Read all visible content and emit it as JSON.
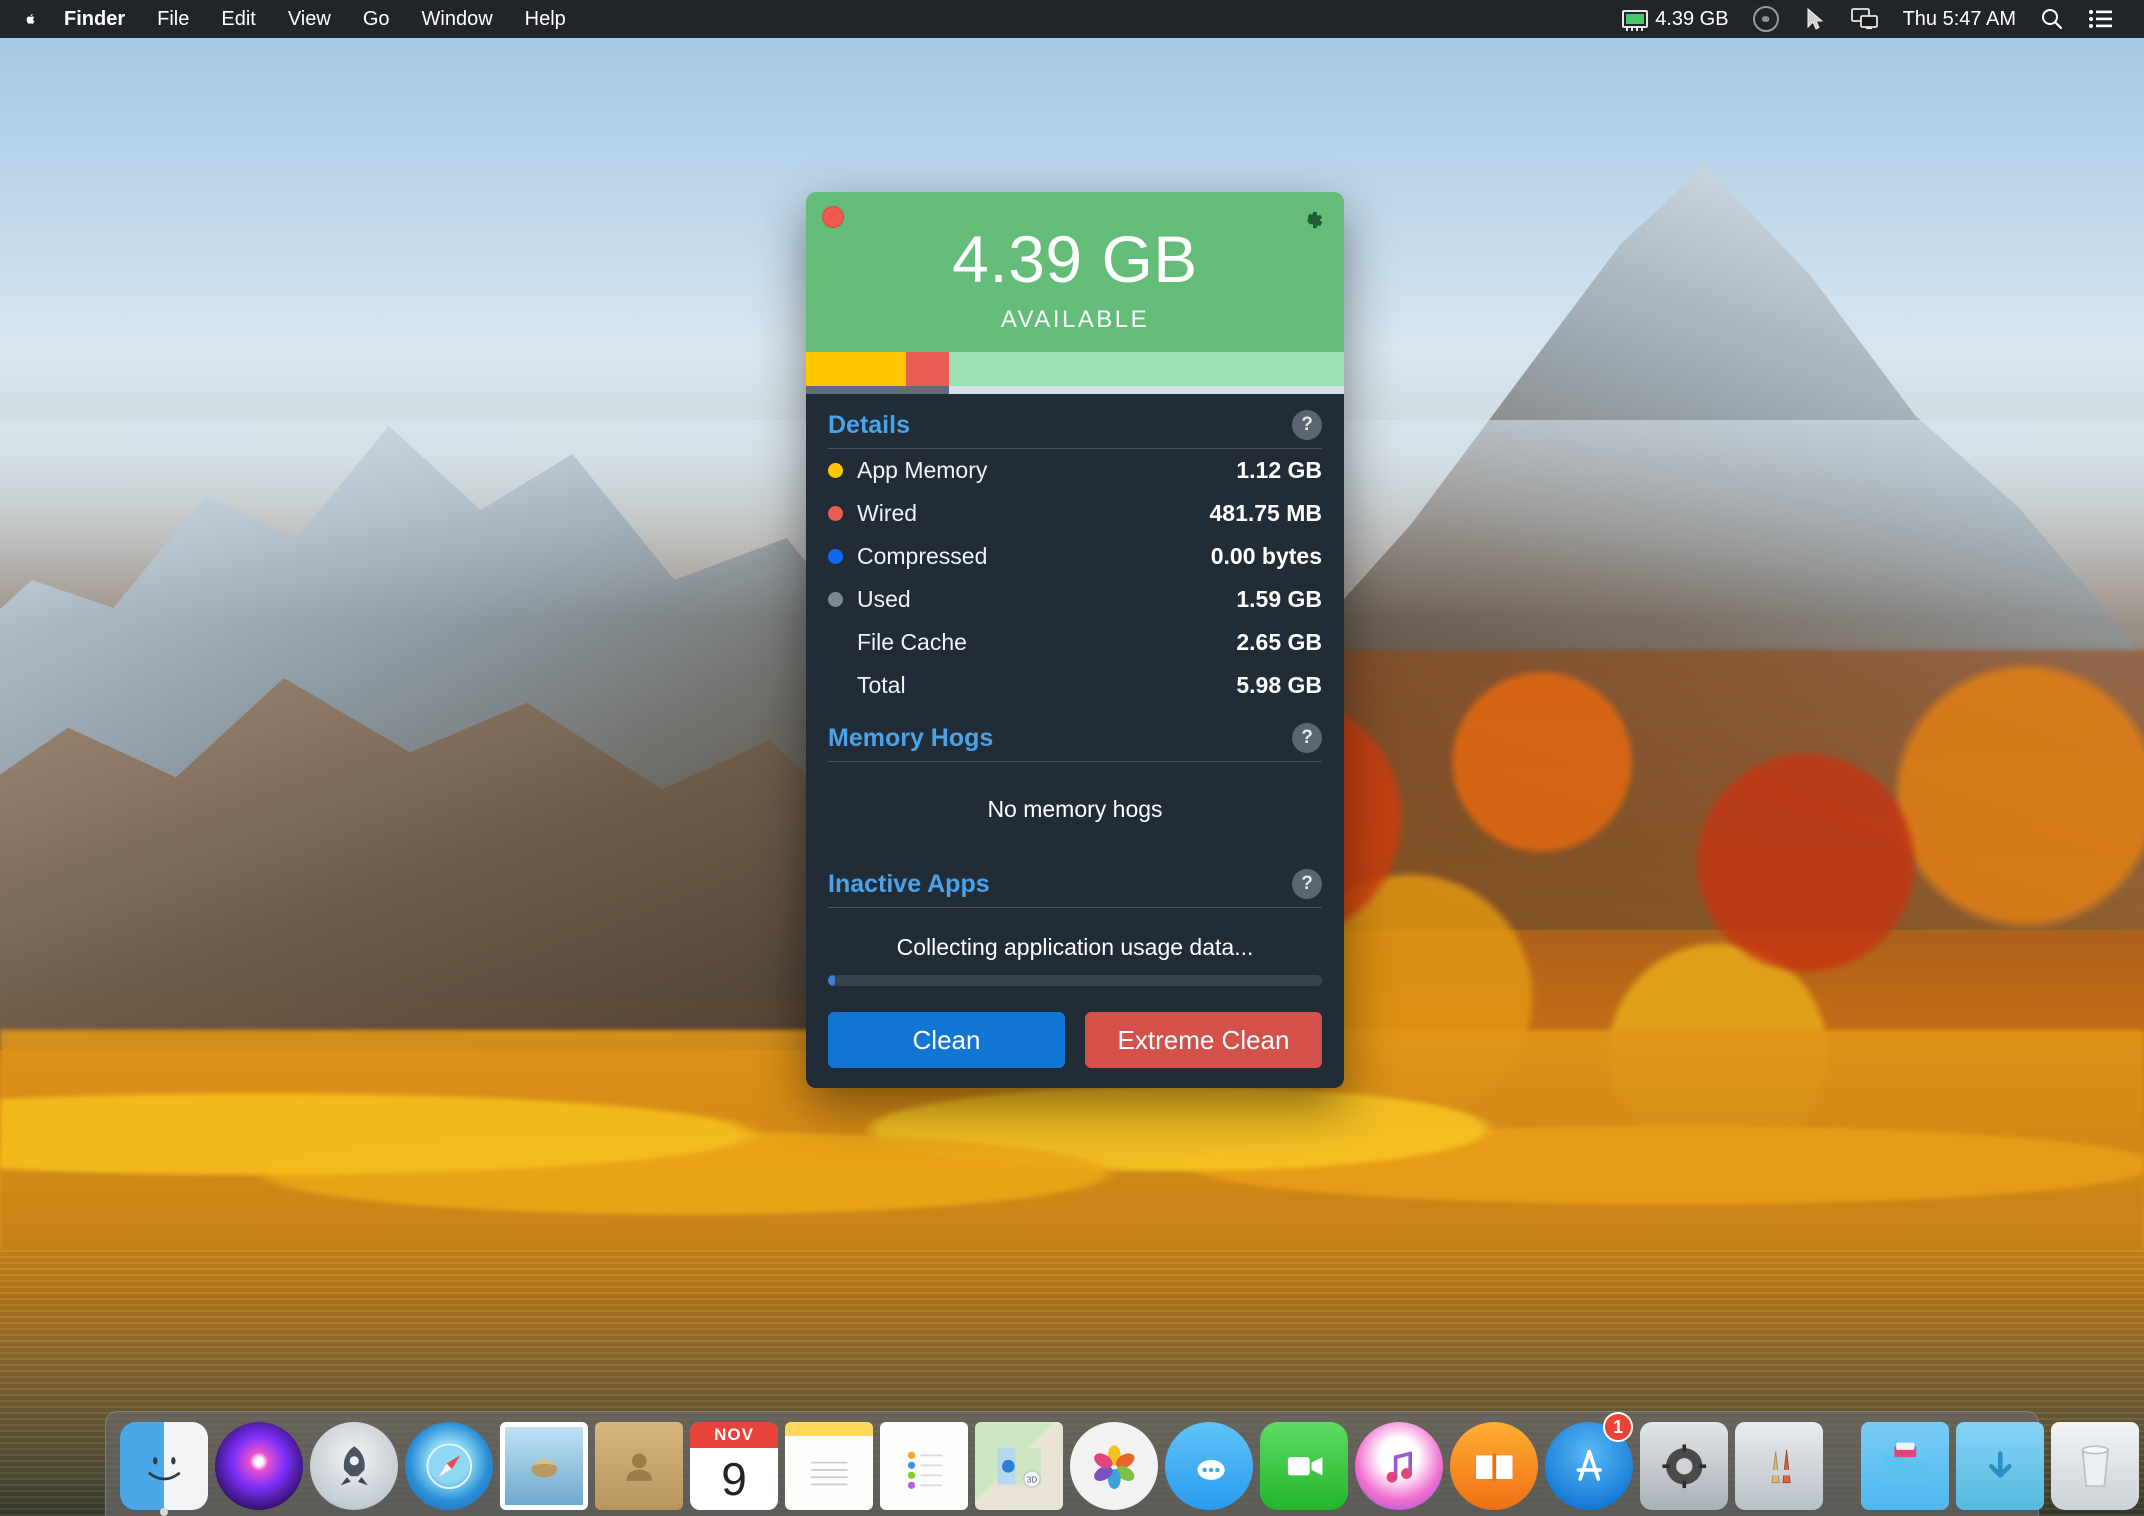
{
  "menubar": {
    "apple_icon": "apple-logo-icon",
    "items": [
      {
        "label": "Finder",
        "bold": true
      },
      {
        "label": "File",
        "bold": false
      },
      {
        "label": "Edit",
        "bold": false
      },
      {
        "label": "View",
        "bold": false
      },
      {
        "label": "Go",
        "bold": false
      },
      {
        "label": "Window",
        "bold": false
      },
      {
        "label": "Help",
        "bold": false
      }
    ],
    "status": {
      "memory_icon": "memory-chip-icon",
      "memory_value": "4.39 GB",
      "creative_cloud_icon": "adobe-creative-cloud-icon",
      "pointer_icon": "cursor-pointer-icon",
      "display_icon": "screen-mirroring-icon",
      "clock": "Thu 5:47 AM",
      "search_icon": "search-icon",
      "control_center_icon": "control-center-list-icon"
    }
  },
  "window": {
    "close_button": "close-window-dot",
    "gear_button": "settings-gear-icon",
    "available_value": "4.39 GB",
    "available_label": "AVAILABLE",
    "usage_bar": {
      "app_memory_percent": 18.6,
      "wired_percent": 8.0,
      "free_percent": 73.4,
      "colors": {
        "app_memory": "#ffc800",
        "wired": "#e95e52",
        "free": "#9ce0b4",
        "header": "#63bd79"
      }
    },
    "details": {
      "title": "Details",
      "help_label": "?",
      "rows": [
        {
          "label": "App Memory",
          "value": "1.12 GB",
          "dot": "#ffc800"
        },
        {
          "label": "Wired",
          "value": "481.75 MB",
          "dot": "#e95e52"
        },
        {
          "label": "Compressed",
          "value": "0.00 bytes",
          "dot": "#1167ef"
        },
        {
          "label": "Used",
          "value": "1.59 GB",
          "dot": "#7a8894"
        },
        {
          "label": "File Cache",
          "value": "2.65 GB",
          "dot": "none"
        },
        {
          "label": "Total",
          "value": "5.98 GB",
          "dot": "none"
        }
      ]
    },
    "memory_hogs": {
      "title": "Memory Hogs",
      "help_label": "?",
      "empty_message": "No memory hogs"
    },
    "inactive_apps": {
      "title": "Inactive Apps",
      "help_label": "?",
      "status_message": "Collecting application usage data...",
      "progress_percent": 1.5
    },
    "buttons": {
      "clean": "Clean",
      "extreme_clean": "Extreme Clean",
      "clean_color": "#1277d4",
      "extreme_color": "#d3504b"
    }
  },
  "dock": {
    "items": [
      {
        "name": "finder",
        "label": "Finder",
        "running": true
      },
      {
        "name": "siri",
        "label": "Siri",
        "running": false
      },
      {
        "name": "launchpad",
        "label": "Launchpad",
        "running": false
      },
      {
        "name": "safari",
        "label": "Safari",
        "running": false
      },
      {
        "name": "mail",
        "label": "Mail",
        "running": false
      },
      {
        "name": "contacts",
        "label": "Contacts",
        "running": false
      },
      {
        "name": "calendar",
        "label": "Calendar",
        "running": false,
        "month": "NOV",
        "day": "9"
      },
      {
        "name": "notes",
        "label": "Notes",
        "running": false
      },
      {
        "name": "reminders",
        "label": "Reminders",
        "running": false
      },
      {
        "name": "maps",
        "label": "Maps",
        "running": false,
        "badge_text": "3D"
      },
      {
        "name": "photos",
        "label": "Photos",
        "running": false
      },
      {
        "name": "messages",
        "label": "Messages",
        "running": false
      },
      {
        "name": "facetime",
        "label": "FaceTime",
        "running": false
      },
      {
        "name": "itunes",
        "label": "iTunes",
        "running": false
      },
      {
        "name": "ibooks",
        "label": "iBooks",
        "running": false
      },
      {
        "name": "appstore",
        "label": "App Store",
        "running": false,
        "badge": "1"
      },
      {
        "name": "system-preferences",
        "label": "System Preferences",
        "running": false
      },
      {
        "name": "xcode",
        "label": "Xcode",
        "running": false
      }
    ],
    "right_items": [
      {
        "name": "documents-folder",
        "label": "Documents"
      },
      {
        "name": "downloads-folder",
        "label": "Downloads"
      },
      {
        "name": "trash",
        "label": "Trash"
      }
    ]
  }
}
